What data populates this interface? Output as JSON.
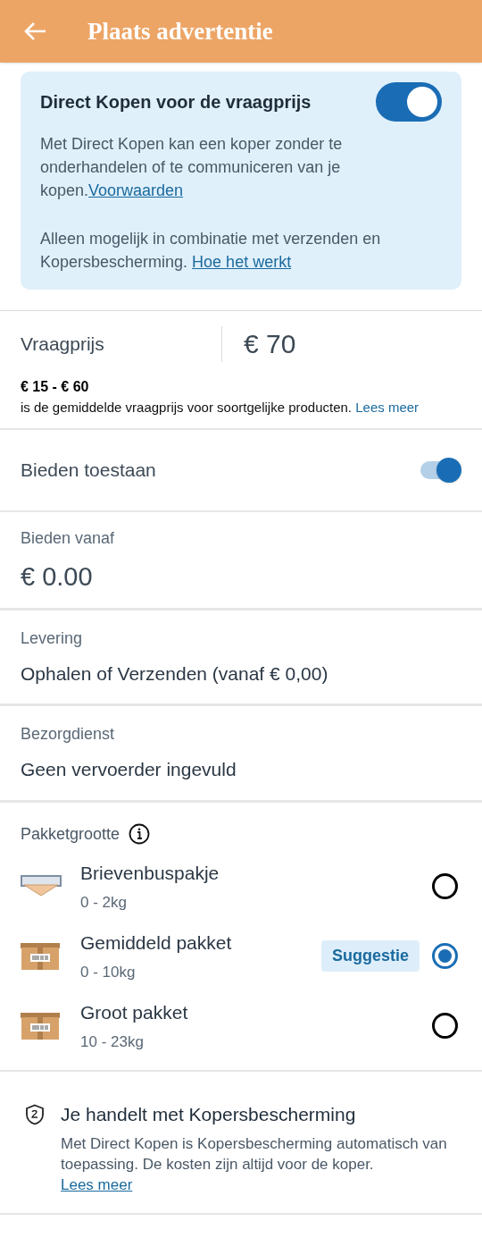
{
  "header": {
    "title": "Plaats advertentie"
  },
  "direct_buy": {
    "title": "Direct Kopen voor de vraagprijs",
    "on": true,
    "text": "Met Direct Kopen kan een koper zonder te onderhandelen of te communiceren van je kopen.",
    "link": "Voorwaarden",
    "note": "Alleen mogelijk in combinatie met verzenden en Kopersbescherming. ",
    "note_link": "Hoe het werkt"
  },
  "price": {
    "label": "Vraagprijs",
    "value": "€ 70",
    "range": "€ 15 - € 60",
    "range_text": "is de gemiddelde vraagprijs voor soortgelijke producten. ",
    "link": "Lees meer"
  },
  "bidding": {
    "label": "Bieden toestaan",
    "on": true
  },
  "bid_from": {
    "label": "Bieden vanaf",
    "value": "€ 0.00"
  },
  "delivery": {
    "label": "Levering",
    "value": "Ophalen of Verzenden (vanaf € 0,00)"
  },
  "carrier": {
    "label": "Bezorgdienst",
    "value": "Geen vervoerder ingevuld"
  },
  "package_size": {
    "label": "Pakketgrootte",
    "options": [
      {
        "kind": "letterbox",
        "name": "Brievenbuspakje",
        "weight": "0 - 2kg",
        "selected": false
      },
      {
        "kind": "box",
        "name": "Gemiddeld pakket",
        "weight": "0 - 10kg",
        "badge": "Suggestie",
        "selected": true
      },
      {
        "kind": "box",
        "name": "Groot pakket",
        "weight": "10 - 23kg",
        "selected": false
      }
    ]
  },
  "protection": {
    "title": "Je handelt met Kopersbescherming",
    "text": "Met Direct Kopen is Kopersbescherming automatisch van toepassing. De kosten zijn altijd voor de koper.",
    "link": "Lees meer"
  }
}
